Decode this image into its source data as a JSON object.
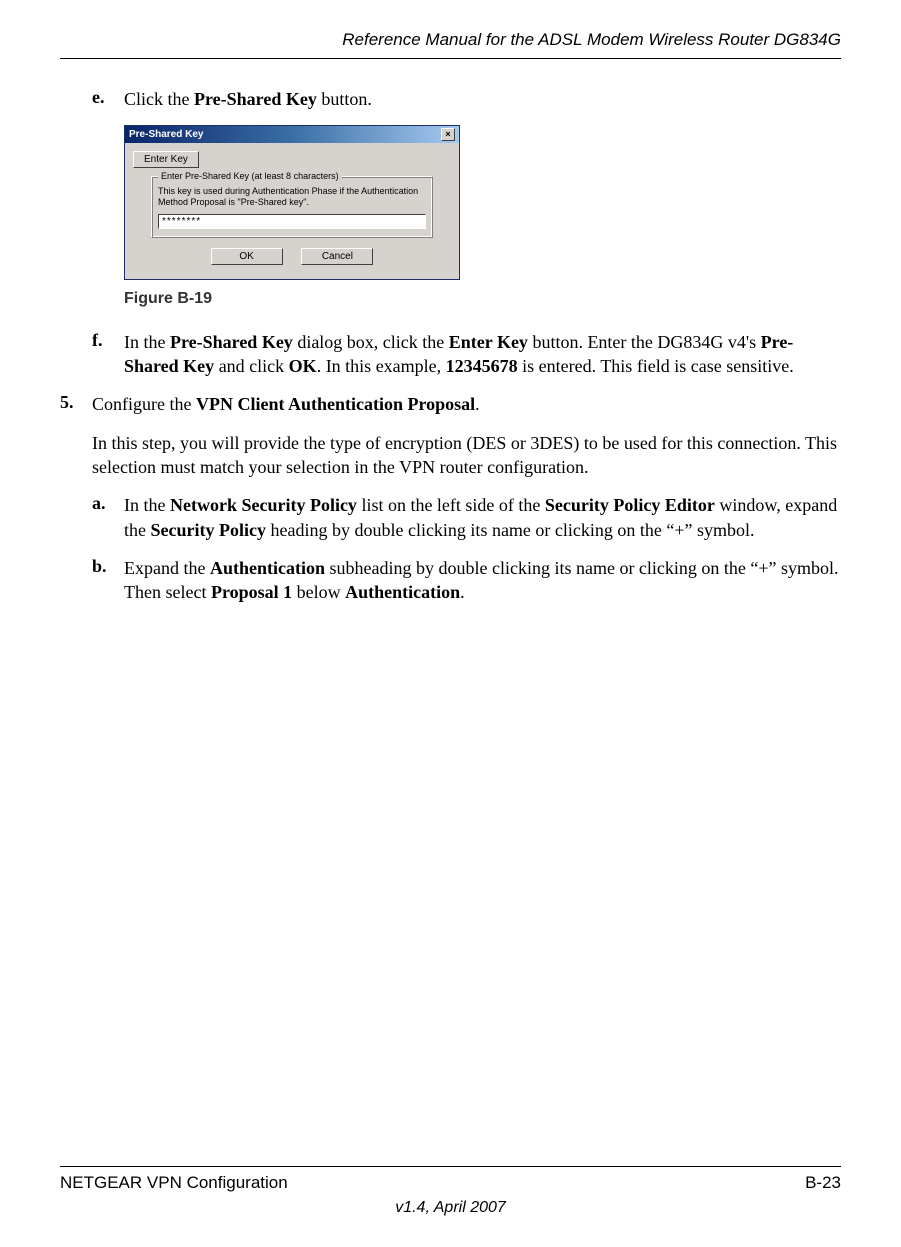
{
  "header": {
    "running_title": "Reference Manual for the ADSL Modem Wireless Router DG834G"
  },
  "steps": {
    "e": {
      "marker": "e.",
      "parts": [
        "Click the ",
        "Pre-Shared Key",
        " button."
      ]
    },
    "f": {
      "marker": "f.",
      "parts": [
        "In the ",
        "Pre-Shared Key",
        " dialog box, click the ",
        "Enter Key",
        " button. Enter the DG834G v4's ",
        "Pre-Shared Key",
        " and click ",
        "OK",
        ". In this example, ",
        "12345678",
        " is entered. This field is case sensitive."
      ]
    },
    "s5": {
      "marker": "5.",
      "parts": [
        "Configure the ",
        "VPN Client Authentication Proposal",
        "."
      ]
    },
    "s5_para": "In this step, you will provide the type of encryption (DES or 3DES) to be used for this connection. This selection must match your selection in the VPN router configuration.",
    "a": {
      "marker": "a.",
      "parts": [
        "In the ",
        "Network Security Policy",
        " list on the left side of the ",
        "Security Policy Editor",
        " window, expand the ",
        "Security Policy",
        " heading by double clicking its name or clicking on the “+” symbol."
      ]
    },
    "b": {
      "marker": "b.",
      "parts": [
        "Expand the ",
        "Authentication",
        " subheading by double clicking its name or clicking on the “+” symbol. Then select ",
        "Proposal 1",
        " below ",
        "Authentication",
        "."
      ]
    }
  },
  "figure": {
    "caption": "Figure B-19",
    "dialog": {
      "title": "Pre-Shared Key",
      "close": "×",
      "enter_key_btn": "Enter Key",
      "group_label": "Enter Pre-Shared Key (at least 8 characters)",
      "group_text": "This key is used during Authentication Phase if the Authentication Method Proposal is \"Pre-Shared key\".",
      "input_value": "********",
      "ok": "OK",
      "cancel": "Cancel"
    }
  },
  "footer": {
    "left": "NETGEAR VPN Configuration",
    "right": "B-23",
    "version": "v1.4, April 2007"
  }
}
